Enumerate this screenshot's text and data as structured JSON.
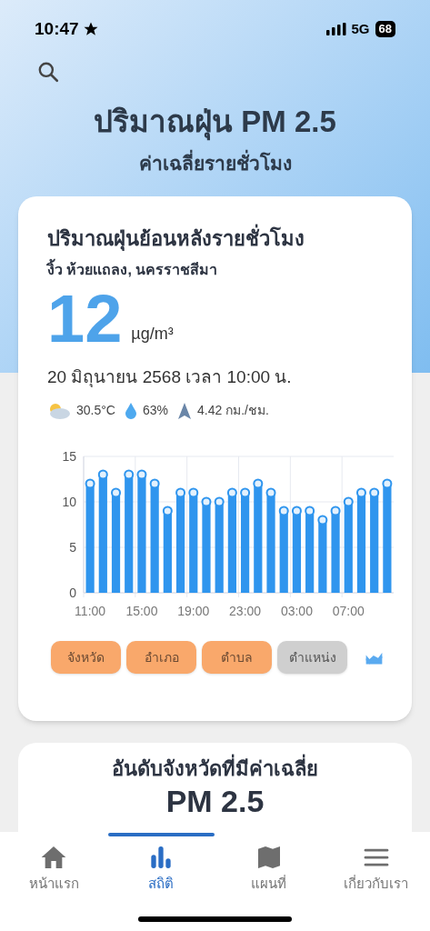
{
  "status_bar": {
    "time": "10:47",
    "network": "5G",
    "battery": "68"
  },
  "header": {
    "title": "ปริมาณฝุ่น PM 2.5",
    "subtitle": "ค่าเฉลี่ยรายชั่วโมง"
  },
  "hourly_card": {
    "title": "ปริมาณฝุ่นย้อนหลังรายชั่วโมง",
    "location": "งิ้ว ห้วยแถลง, นครราชสีมา",
    "value": "12",
    "unit": "µg/m³",
    "date": "20 มิถุนายน 2568  เวลา 10:00 น.",
    "weather": [
      {
        "kind": "temperature",
        "text": "30.5°C"
      },
      {
        "kind": "humidity",
        "text": "63%"
      },
      {
        "kind": "wind",
        "text": "4.42 กม./ชม."
      }
    ],
    "chart_data": {
      "type": "bar",
      "categories": [
        "11:00",
        null,
        null,
        null,
        "15:00",
        null,
        null,
        null,
        "19:00",
        null,
        null,
        null,
        "23:00",
        null,
        null,
        null,
        "03:00",
        null,
        null,
        null,
        "07:00",
        null,
        null,
        null
      ],
      "series": [
        {
          "color": "#2f95ee",
          "values": [
            12,
            13,
            11,
            13,
            13,
            12,
            9,
            11,
            11,
            10,
            10,
            11,
            11,
            12,
            11,
            9,
            9,
            9,
            8,
            9,
            10,
            11,
            11,
            12
          ]
        }
      ],
      "ylim": [
        0,
        15
      ],
      "yticks": [
        0,
        5,
        10,
        15
      ]
    },
    "filters": [
      {
        "label": "จังหวัด",
        "selected": false
      },
      {
        "label": "อำเภอ",
        "selected": false
      },
      {
        "label": "ตำบล",
        "selected": false
      },
      {
        "label": "ตำแหน่ง",
        "selected": true
      }
    ]
  },
  "ranking_card": {
    "title": "อันดับจังหวัดที่มีค่าเฉลี่ย",
    "subtitle": "PM 2.5"
  },
  "tab_bar": [
    {
      "kind": "home",
      "label": "หน้าแรก",
      "selected": false
    },
    {
      "kind": "stats",
      "label": "สถิติ",
      "selected": true
    },
    {
      "kind": "map",
      "label": "แผนที่",
      "selected": false
    },
    {
      "kind": "menu",
      "label": "เกี่ยวกับเรา",
      "selected": false
    }
  ]
}
